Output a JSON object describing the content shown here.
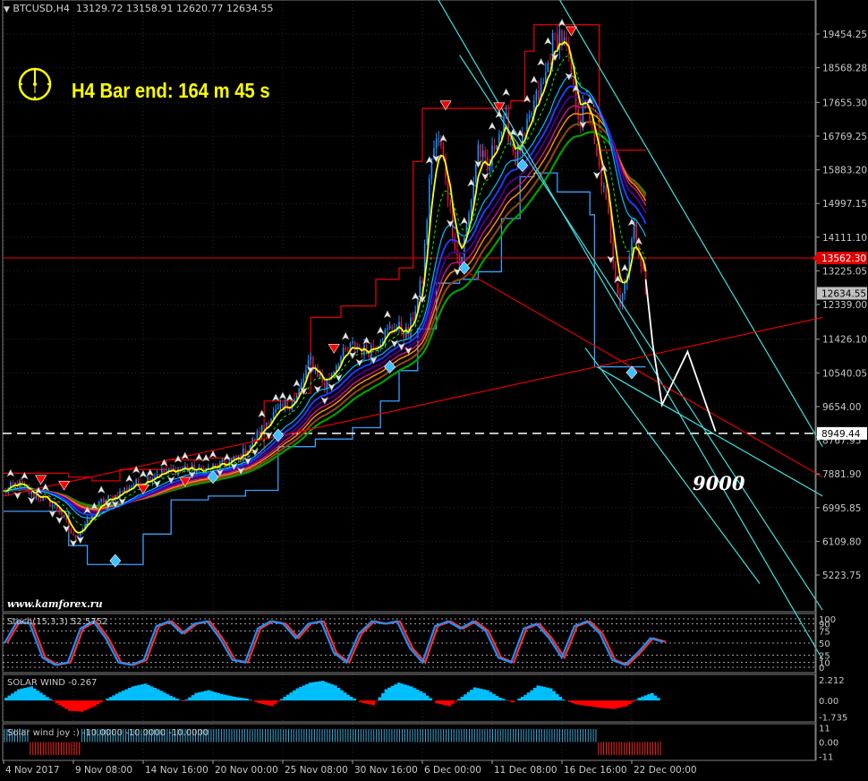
{
  "header": {
    "symbol_tf": "BTCUSD,H4",
    "open": "13129.72",
    "high": "13158.91",
    "low": "12620.77",
    "close": "12634.55",
    "timer_text": "H4 Bar end: 164 m 45 s"
  },
  "watermark": "www.kamforex.ru",
  "target_label": "9000",
  "price_labels": {
    "hline_red": "13562.30",
    "current": "12634.55",
    "hline_white": "8949.44"
  },
  "colors": {
    "background": "#000000",
    "grid": "#1c2b2b",
    "bull_candle": "#1e90ff",
    "bear_candle": "#dc143c",
    "channel_red": "#e00000",
    "channel_blue": "#3aa0ff",
    "trendline_cyan": "#40e0e0",
    "trendline_red": "#e00000",
    "timer_yellow": "#ffff00",
    "solar_pos": "#00bfff",
    "solar_neg": "#ff0000",
    "stoch_main": "#1e90ff",
    "stoch_signal": "#ff3030"
  },
  "chart_data": [
    {
      "type": "candlestick",
      "title": "BTCUSD,H4",
      "y_ticks": [
        19454.25,
        18568.28,
        17655.3,
        16769.25,
        15883.2,
        14997.15,
        14111.1,
        13225.05,
        12339.0,
        11426.1,
        10540.05,
        9654.0,
        8767.95,
        7881.9,
        6995.85,
        6109.8,
        5223.75
      ],
      "ylim": [
        5050,
        20000
      ],
      "x_ticks": [
        "4 Nov 2017",
        "9 Nov 08:00",
        "14 Nov 16:00",
        "20 Nov 00:00",
        "25 Nov 08:00",
        "30 Nov 16:00",
        "6 Dec 00:00",
        "11 Dec 08:00",
        "16 Dec 16:00",
        "22 Dec 00:00"
      ],
      "x_tick_index": [
        0,
        30,
        60,
        90,
        120,
        150,
        180,
        210,
        240,
        270
      ],
      "close_path": [
        [
          0,
          7400
        ],
        [
          6,
          7650
        ],
        [
          12,
          7350
        ],
        [
          18,
          7200
        ],
        [
          24,
          6950
        ],
        [
          30,
          6200
        ],
        [
          36,
          6600
        ],
        [
          42,
          7150
        ],
        [
          48,
          7300
        ],
        [
          54,
          7550
        ],
        [
          60,
          7700
        ],
        [
          66,
          7900
        ],
        [
          72,
          7950
        ],
        [
          78,
          8050
        ],
        [
          84,
          7950
        ],
        [
          90,
          8050
        ],
        [
          96,
          8150
        ],
        [
          102,
          8350
        ],
        [
          108,
          8800
        ],
        [
          114,
          9350
        ],
        [
          120,
          9600
        ],
        [
          126,
          9900
        ],
        [
          132,
          10900
        ],
        [
          138,
          10200
        ],
        [
          144,
          10900
        ],
        [
          150,
          11250
        ],
        [
          156,
          11100
        ],
        [
          162,
          11450
        ],
        [
          168,
          11800
        ],
        [
          174,
          11550
        ],
        [
          180,
          13000
        ],
        [
          184,
          16300
        ],
        [
          187,
          16700
        ],
        [
          190,
          15800
        ],
        [
          193,
          14300
        ],
        [
          196,
          13300
        ],
        [
          200,
          14700
        ],
        [
          204,
          16500
        ],
        [
          208,
          15800
        ],
        [
          212,
          16800
        ],
        [
          216,
          17100
        ],
        [
          220,
          16200
        ],
        [
          224,
          16700
        ],
        [
          228,
          17600
        ],
        [
          232,
          18100
        ],
        [
          236,
          19200
        ],
        [
          239,
          19450
        ],
        [
          242,
          19000
        ],
        [
          245,
          17900
        ],
        [
          248,
          17200
        ],
        [
          251,
          17700
        ],
        [
          254,
          16400
        ],
        [
          257,
          15600
        ],
        [
          260,
          14600
        ],
        [
          263,
          13100
        ],
        [
          265,
          12350
        ],
        [
          267,
          12900
        ],
        [
          269,
          13700
        ],
        [
          271,
          14300
        ],
        [
          273,
          13800
        ],
        [
          275,
          13129
        ],
        [
          276,
          12634
        ]
      ],
      "channel_upper": [
        [
          0,
          7900
        ],
        [
          20,
          7900
        ],
        [
          28,
          7800
        ],
        [
          38,
          7700
        ],
        [
          50,
          8000
        ],
        [
          70,
          8250
        ],
        [
          88,
          8300
        ],
        [
          104,
          8450
        ],
        [
          112,
          9800
        ],
        [
          125,
          10000
        ],
        [
          132,
          12000
        ],
        [
          145,
          12300
        ],
        [
          160,
          13000
        ],
        [
          170,
          13300
        ],
        [
          176,
          16100
        ],
        [
          180,
          17500
        ],
        [
          210,
          17500
        ],
        [
          218,
          17700
        ],
        [
          224,
          19000
        ],
        [
          228,
          19700
        ],
        [
          250,
          19700
        ],
        [
          256,
          16400
        ],
        [
          276,
          16400
        ]
      ],
      "channel_lower": [
        [
          0,
          6900
        ],
        [
          28,
          6000
        ],
        [
          36,
          5500
        ],
        [
          50,
          5500
        ],
        [
          60,
          6300
        ],
        [
          72,
          7200
        ],
        [
          88,
          7300
        ],
        [
          104,
          7450
        ],
        [
          118,
          8600
        ],
        [
          134,
          8800
        ],
        [
          150,
          9100
        ],
        [
          162,
          9800
        ],
        [
          170,
          10600
        ],
        [
          178,
          11700
        ],
        [
          186,
          12900
        ],
        [
          196,
          13000
        ],
        [
          204,
          13200
        ],
        [
          214,
          14600
        ],
        [
          222,
          15700
        ],
        [
          228,
          15800
        ],
        [
          236,
          15800
        ],
        [
          238,
          15300
        ],
        [
          252,
          14700
        ],
        [
          254,
          10700
        ],
        [
          276,
          10700
        ]
      ],
      "zigzag_projection": [
        [
          276,
          13000
        ],
        [
          279,
          11300
        ],
        [
          283,
          9700
        ],
        [
          294,
          11100
        ],
        [
          306,
          9000
        ]
      ],
      "hlines": [
        13562.3,
        8949.44
      ],
      "trendlines": [
        {
          "color": "cyan",
          "points": [
            [
              176,
              21500
            ],
            [
              352,
              3000
            ]
          ]
        },
        {
          "color": "cyan",
          "points": [
            [
              228,
              21500
            ],
            [
              352,
              8600
            ]
          ]
        },
        {
          "color": "cyan",
          "points": [
            [
              196,
              18900
            ],
            [
              352,
              4300
            ]
          ]
        },
        {
          "color": "cyan",
          "points": [
            [
              255,
              10700
            ],
            [
              352,
              7300
            ]
          ]
        },
        {
          "color": "cyan",
          "points": [
            [
              250,
              11200
            ],
            [
              325,
              5000
            ]
          ]
        },
        {
          "color": "red",
          "points": [
            [
              0,
              7300
            ],
            [
              352,
              12000
            ]
          ]
        },
        {
          "color": "red",
          "points": [
            [
              196,
              13300
            ],
            [
              352,
              7800
            ]
          ]
        }
      ]
    },
    {
      "type": "line",
      "title": "Stoch(15,3,3) 52.5752",
      "y_ticks": [
        100,
        90,
        75,
        50,
        25,
        10,
        0
      ],
      "ylim": [
        0,
        100
      ],
      "series": [
        {
          "name": "Stoch",
          "values": [
            50,
            95,
            90,
            20,
            5,
            10,
            80,
            95,
            60,
            10,
            5,
            15,
            85,
            95,
            70,
            90,
            95,
            60,
            15,
            10,
            80,
            95,
            90,
            60,
            90,
            95,
            30,
            10,
            70,
            95,
            90,
            95,
            40,
            10,
            85,
            95,
            80,
            95,
            75,
            20,
            10,
            80,
            90,
            60,
            20,
            85,
            95,
            70,
            15,
            5,
            30,
            60,
            52.5752
          ]
        }
      ]
    },
    {
      "type": "area",
      "title": "SOLAR WIND -0.267",
      "y_ticks": [
        2.212,
        0.0,
        -1.735
      ],
      "ylim": [
        -1.9,
        2.4
      ],
      "series": [
        {
          "name": "SOLAR WIND",
          "values": [
            0.3,
            1.2,
            1.5,
            0.6,
            -0.3,
            -1.1,
            -1.2,
            -0.6,
            0.2,
            0.9,
            1.5,
            1.8,
            1.2,
            0.5,
            -0.1,
            0.8,
            1.1,
            0.7,
            0.4,
            0.2,
            -0.3,
            -0.6,
            0.4,
            1.3,
            1.9,
            2.1,
            1.6,
            0.6,
            -0.2,
            -0.5,
            1.2,
            1.9,
            1.5,
            0.8,
            -0.3,
            -0.6,
            0.4,
            1.4,
            1.1,
            0.3,
            -0.2,
            0.6,
            1.6,
            1.3,
            0.1,
            -0.4,
            -0.6,
            -0.8,
            -0.9,
            -0.6,
            0.3,
            0.8,
            -0.267
          ]
        }
      ]
    },
    {
      "type": "bar",
      "title": "Solar wind joy :) -10.0000 -10.0000 -10.0000",
      "y_ticks": [
        11,
        0.0,
        -11
      ],
      "ylim": [
        -12,
        12
      ],
      "series": [
        {
          "name": "Solar wind joy",
          "values": [
            10,
            10,
            -10,
            -10,
            -10,
            -10,
            10,
            10,
            10,
            10,
            10,
            10,
            10,
            10,
            10,
            10,
            10,
            10,
            10,
            10,
            10,
            10,
            10,
            10,
            10,
            10,
            10,
            10,
            10,
            10,
            10,
            10,
            10,
            10,
            10,
            10,
            10,
            10,
            10,
            10,
            10,
            10,
            10,
            10,
            10,
            10,
            -10,
            -10,
            -10,
            -10,
            -10,
            -10
          ]
        }
      ]
    }
  ]
}
